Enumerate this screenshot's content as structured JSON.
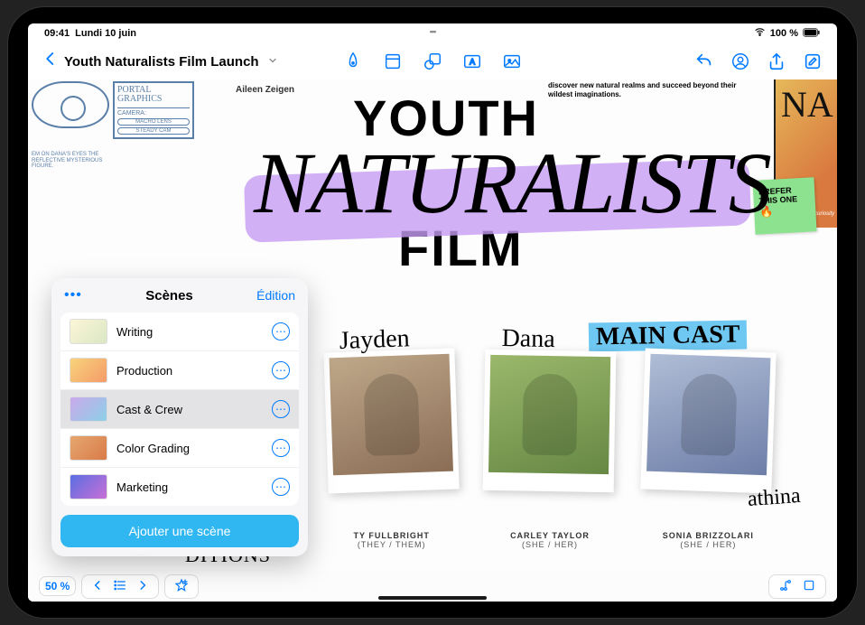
{
  "status": {
    "time": "09:41",
    "date": "Lundi 10 juin",
    "battery": "100 %",
    "wifi_icon": "wifi",
    "battery_icon": "battery-full"
  },
  "toolbar": {
    "doc_title": "Youth Naturalists Film Launch",
    "back_icon": "chevron-left",
    "title_chevron_icon": "chevron-down",
    "center_icons": [
      "pen-tool-icon",
      "sticky-note-icon",
      "shape-icon",
      "text-box-icon",
      "media-icon"
    ],
    "right_icons": [
      "undo-icon",
      "collaborate-icon",
      "share-icon",
      "edit-icon"
    ]
  },
  "canvas": {
    "author": "Aileen Zeigen",
    "heading_line1": "YOUTH",
    "heading_line2": "NATURALISTS",
    "heading_line3": "FILM",
    "right_desc": "discover new natural realms and succeed beyond their wildest imaginations.",
    "main_cast_label": "MAIN CAST",
    "sticky_note": {
      "text": "PREFER THIS ONE",
      "emoji": "🔥"
    },
    "right_poster_fragment": "NA",
    "right_poster_tagline": "\"The quest for curiosity begins.\"",
    "planning_card": {
      "graphics_label": "PORTAL GRAPHICS",
      "camera_label": "CAMERA:",
      "pill1": "MACRO LENS",
      "pill2": "STEADY CAM"
    },
    "under_eye": "EM ON DANA'S EYES\nTHE REFLECTIVE\nMYSTERIOUS FIGURE.",
    "cast": [
      {
        "signature": "Jayden",
        "name": "TY FULLBRIGHT",
        "pronouns": "(THEY / THEM)"
      },
      {
        "signature": "Dana",
        "name": "CARLEY TAYLOR",
        "pronouns": "(SHE / HER)"
      },
      {
        "signature": "",
        "name": "SONIA BRIZZOLARI",
        "pronouns": "(SHE / HER)"
      }
    ],
    "extra_signature": "athina",
    "bottom_word_fragment": "DITIONS"
  },
  "scenes_popover": {
    "more_icon": "•••",
    "title": "Scènes",
    "edit_label": "Édition",
    "items": [
      {
        "label": "Writing"
      },
      {
        "label": "Production"
      },
      {
        "label": "Cast & Crew"
      },
      {
        "label": "Color Grading"
      },
      {
        "label": "Marketing"
      }
    ],
    "selected_index": 2,
    "add_button": "Ajouter une scène",
    "row_more_icon": "ellipsis-circle"
  },
  "bottom_bar": {
    "zoom": "50 %",
    "nav_prev_icon": "chevron-left",
    "nav_list_icon": "list-bullet",
    "nav_next_icon": "chevron-right",
    "nav_star_icon": "star-plus",
    "br_connector_icon": "connector",
    "br_frame_icon": "frame"
  }
}
